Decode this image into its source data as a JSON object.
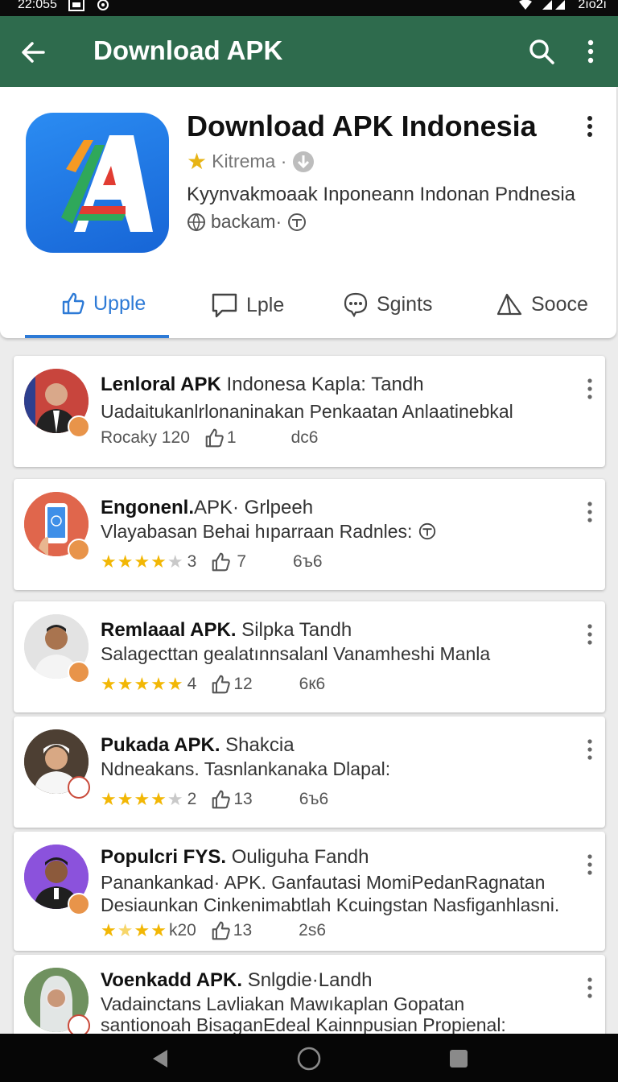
{
  "status_bar": {
    "time": "22:055",
    "battery_text": "2ıo2ı"
  },
  "app_bar": {
    "title": "Download APK"
  },
  "app": {
    "title": "Download APK Indonesia",
    "developer": "Kitrema ·",
    "description": "Kyynvakmoaak Inponeann Indonan Pndnesia",
    "backup": "backam·"
  },
  "tabs": [
    {
      "label": "Upple"
    },
    {
      "label": "Lple"
    },
    {
      "label": "Sgints"
    },
    {
      "label": "Sooce"
    }
  ],
  "posts": [
    {
      "title_bold": "Lenloral APK",
      "title_rest": " Indonesa Kapla: Tandh",
      "lines": [
        "Uadaitukanlrlonaninakan Penkaatan Anlaatinebkal"
      ],
      "rating_text": "Rocaky 120",
      "likes": "1",
      "extra": "dc6",
      "stars": 0
    },
    {
      "title_bold": "Engonenl.",
      "title_rest": "APK· Grlpeeh",
      "lines": [
        "Vlayabasan Behai hıparraan Radnles:"
      ],
      "rating_text": "3",
      "likes": "7",
      "extra": "6ъ6",
      "stars": 3.5
    },
    {
      "title_bold": "Remlaaal APK.",
      "title_rest": " Silpka Tandh",
      "lines": [
        "Salagecttan gealatınnsalanl Vanamheshi Manla"
      ],
      "rating_text": "4",
      "likes": "12",
      "extra": "6к6",
      "stars": 4.5
    },
    {
      "title_bold": "Pukada APK.",
      "title_rest": " Shakcia",
      "lines": [
        "Ndneakans. Tasnlankanaka Dlapal:"
      ],
      "rating_text": "2",
      "likes": "13",
      "extra": "6ъ6",
      "stars": 3.5
    },
    {
      "title_bold": "Populcri FYS.",
      "title_rest": " Ouliguha Fandh",
      "lines": [
        "Panankankad· APK. Ganfautasi MomiPedanRagnatan",
        "Desiaunkan Cinkenimabtlah Kcuingstan Nasfiganhlasni."
      ],
      "rating_text": "k20",
      "likes": "13",
      "extra": "2s6",
      "stars": 3.5
    },
    {
      "title_bold": "Voenkadd APK.",
      "title_rest": " Snlgdie·Landh",
      "lines": [
        "Vadainctans Lavliakan Mawıkaplan Gopatan",
        "santionoah BisaganEdeal Kainnpusian Propienal:"
      ],
      "rating_text": "",
      "likes": "",
      "extra": "",
      "stars": 0
    }
  ],
  "colors": {
    "app_bar": "#2e6b4d",
    "accent": "#2d7ad6",
    "star": "#f2b705",
    "badge": "#e8944a"
  }
}
